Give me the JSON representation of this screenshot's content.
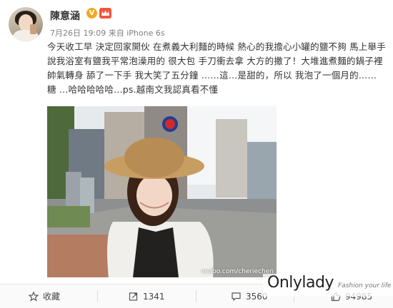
{
  "user": {
    "name": "陳意涵",
    "verified_badge": "V"
  },
  "post": {
    "date": "7月26日 19:09",
    "source_prefix": "来自",
    "source": "iPhone 6s",
    "text": "今天收工早 決定回家開伙 在煮義大利麵的時候 熱心的我擔心小罐的鹽不夠 馬上舉手說我浴室有鹽我平常泡澡用的 很大包 手刀衝去拿 大方的撒了！大堆進煮麵的鍋子裡 帥氣轉身 舔了一下手 我大笑了五分鐘 ……這…是甜的，所以 我泡了一個月的…… 糖 …哈哈哈哈哈…ps.越南文我認真看不懂",
    "photo_watermark": "weibo.com/cheriechen"
  },
  "actions": {
    "favorite_label": "收藏",
    "repost_count": "1341",
    "comment_count": "3560",
    "like_count": "94985"
  },
  "brand": {
    "logo": "Onlylady",
    "tagline": "Fashion your life"
  },
  "colors": {
    "verified": "#f5a623",
    "vip": "#f0563e"
  }
}
